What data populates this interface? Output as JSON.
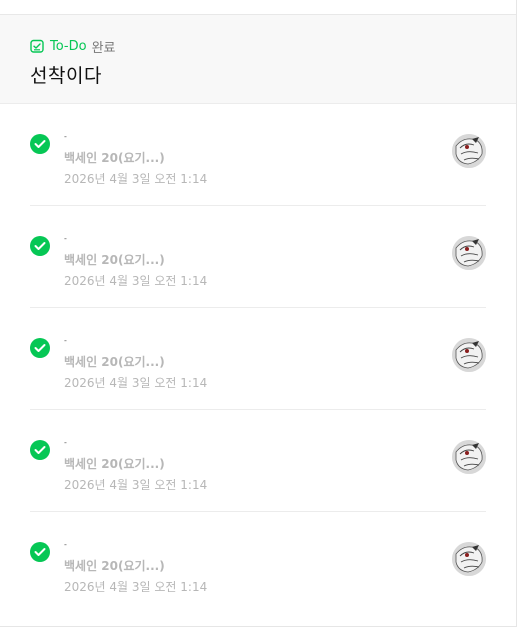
{
  "header": {
    "category": "To-Do",
    "state": "완료",
    "title": "선착이다"
  },
  "items": [
    {
      "mark": "-",
      "author": "백세인 20(요기...)",
      "time": "2026년 4월 3일 오전 1:14"
    },
    {
      "mark": "-",
      "author": "백세인 20(요기...)",
      "time": "2026년 4월 3일 오전 1:14"
    },
    {
      "mark": "-",
      "author": "백세인 20(요기...)",
      "time": "2026년 4월 3일 오전 1:14"
    },
    {
      "mark": "-",
      "author": "백세인 20(요기...)",
      "time": "2026년 4월 3일 오전 1:14"
    },
    {
      "mark": "-",
      "author": "백세인 20(요기...)",
      "time": "2026년 4월 3일 오전 1:14"
    }
  ],
  "icons": {
    "category": "todo-icon",
    "status": "check-circle-icon",
    "user": "avatar"
  },
  "colors": {
    "accent": "#06c755",
    "meta": "#b7b7b7"
  }
}
